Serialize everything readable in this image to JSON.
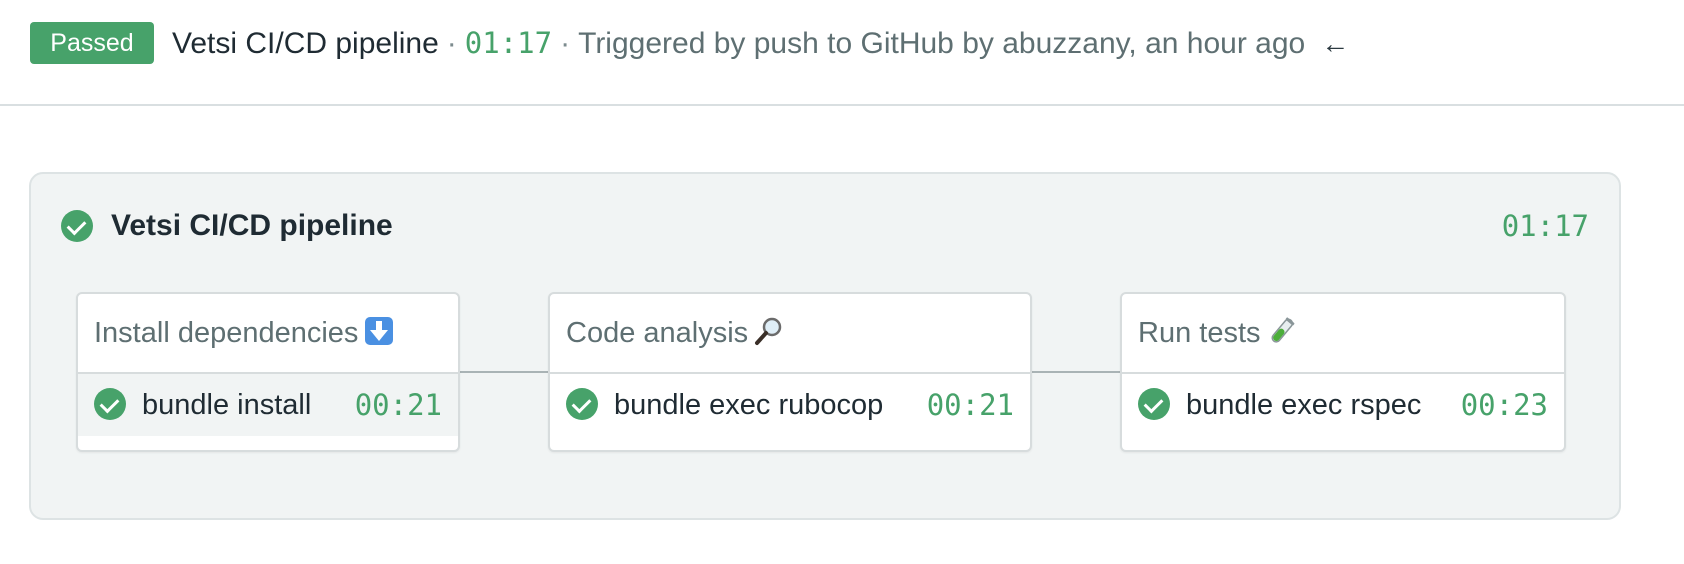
{
  "header": {
    "status_badge": "Passed",
    "pipeline_name": "Vetsi CI/CD pipeline",
    "separator": "·",
    "duration": "01:17",
    "trigger_text": "Triggered by push to GitHub by abuzzany, an hour ago",
    "back_arrow": "←"
  },
  "pipeline": {
    "title": "Vetsi CI/CD pipeline",
    "duration": "01:17",
    "status_icon": "success-check-icon",
    "blocks": [
      {
        "name": "Install dependencies",
        "emoji_icon": "down-arrow-emoji-icon",
        "jobs": [
          {
            "label": "bundle install",
            "duration": "00:21",
            "status_icon": "success-check-icon"
          }
        ]
      },
      {
        "name": "Code analysis",
        "emoji_icon": "magnifying-glass-emoji-icon",
        "jobs": [
          {
            "label": "bundle exec rubocop",
            "duration": "00:21",
            "status_icon": "success-check-icon"
          }
        ]
      },
      {
        "name": "Run tests",
        "emoji_icon": "test-tube-emoji-icon",
        "jobs": [
          {
            "label": "bundle exec rspec",
            "duration": "00:23",
            "status_icon": "success-check-icon"
          }
        ]
      }
    ]
  },
  "colors": {
    "success": "#47a26a",
    "muted_text": "#5e6f72",
    "panel_background": "#f1f4f4"
  }
}
